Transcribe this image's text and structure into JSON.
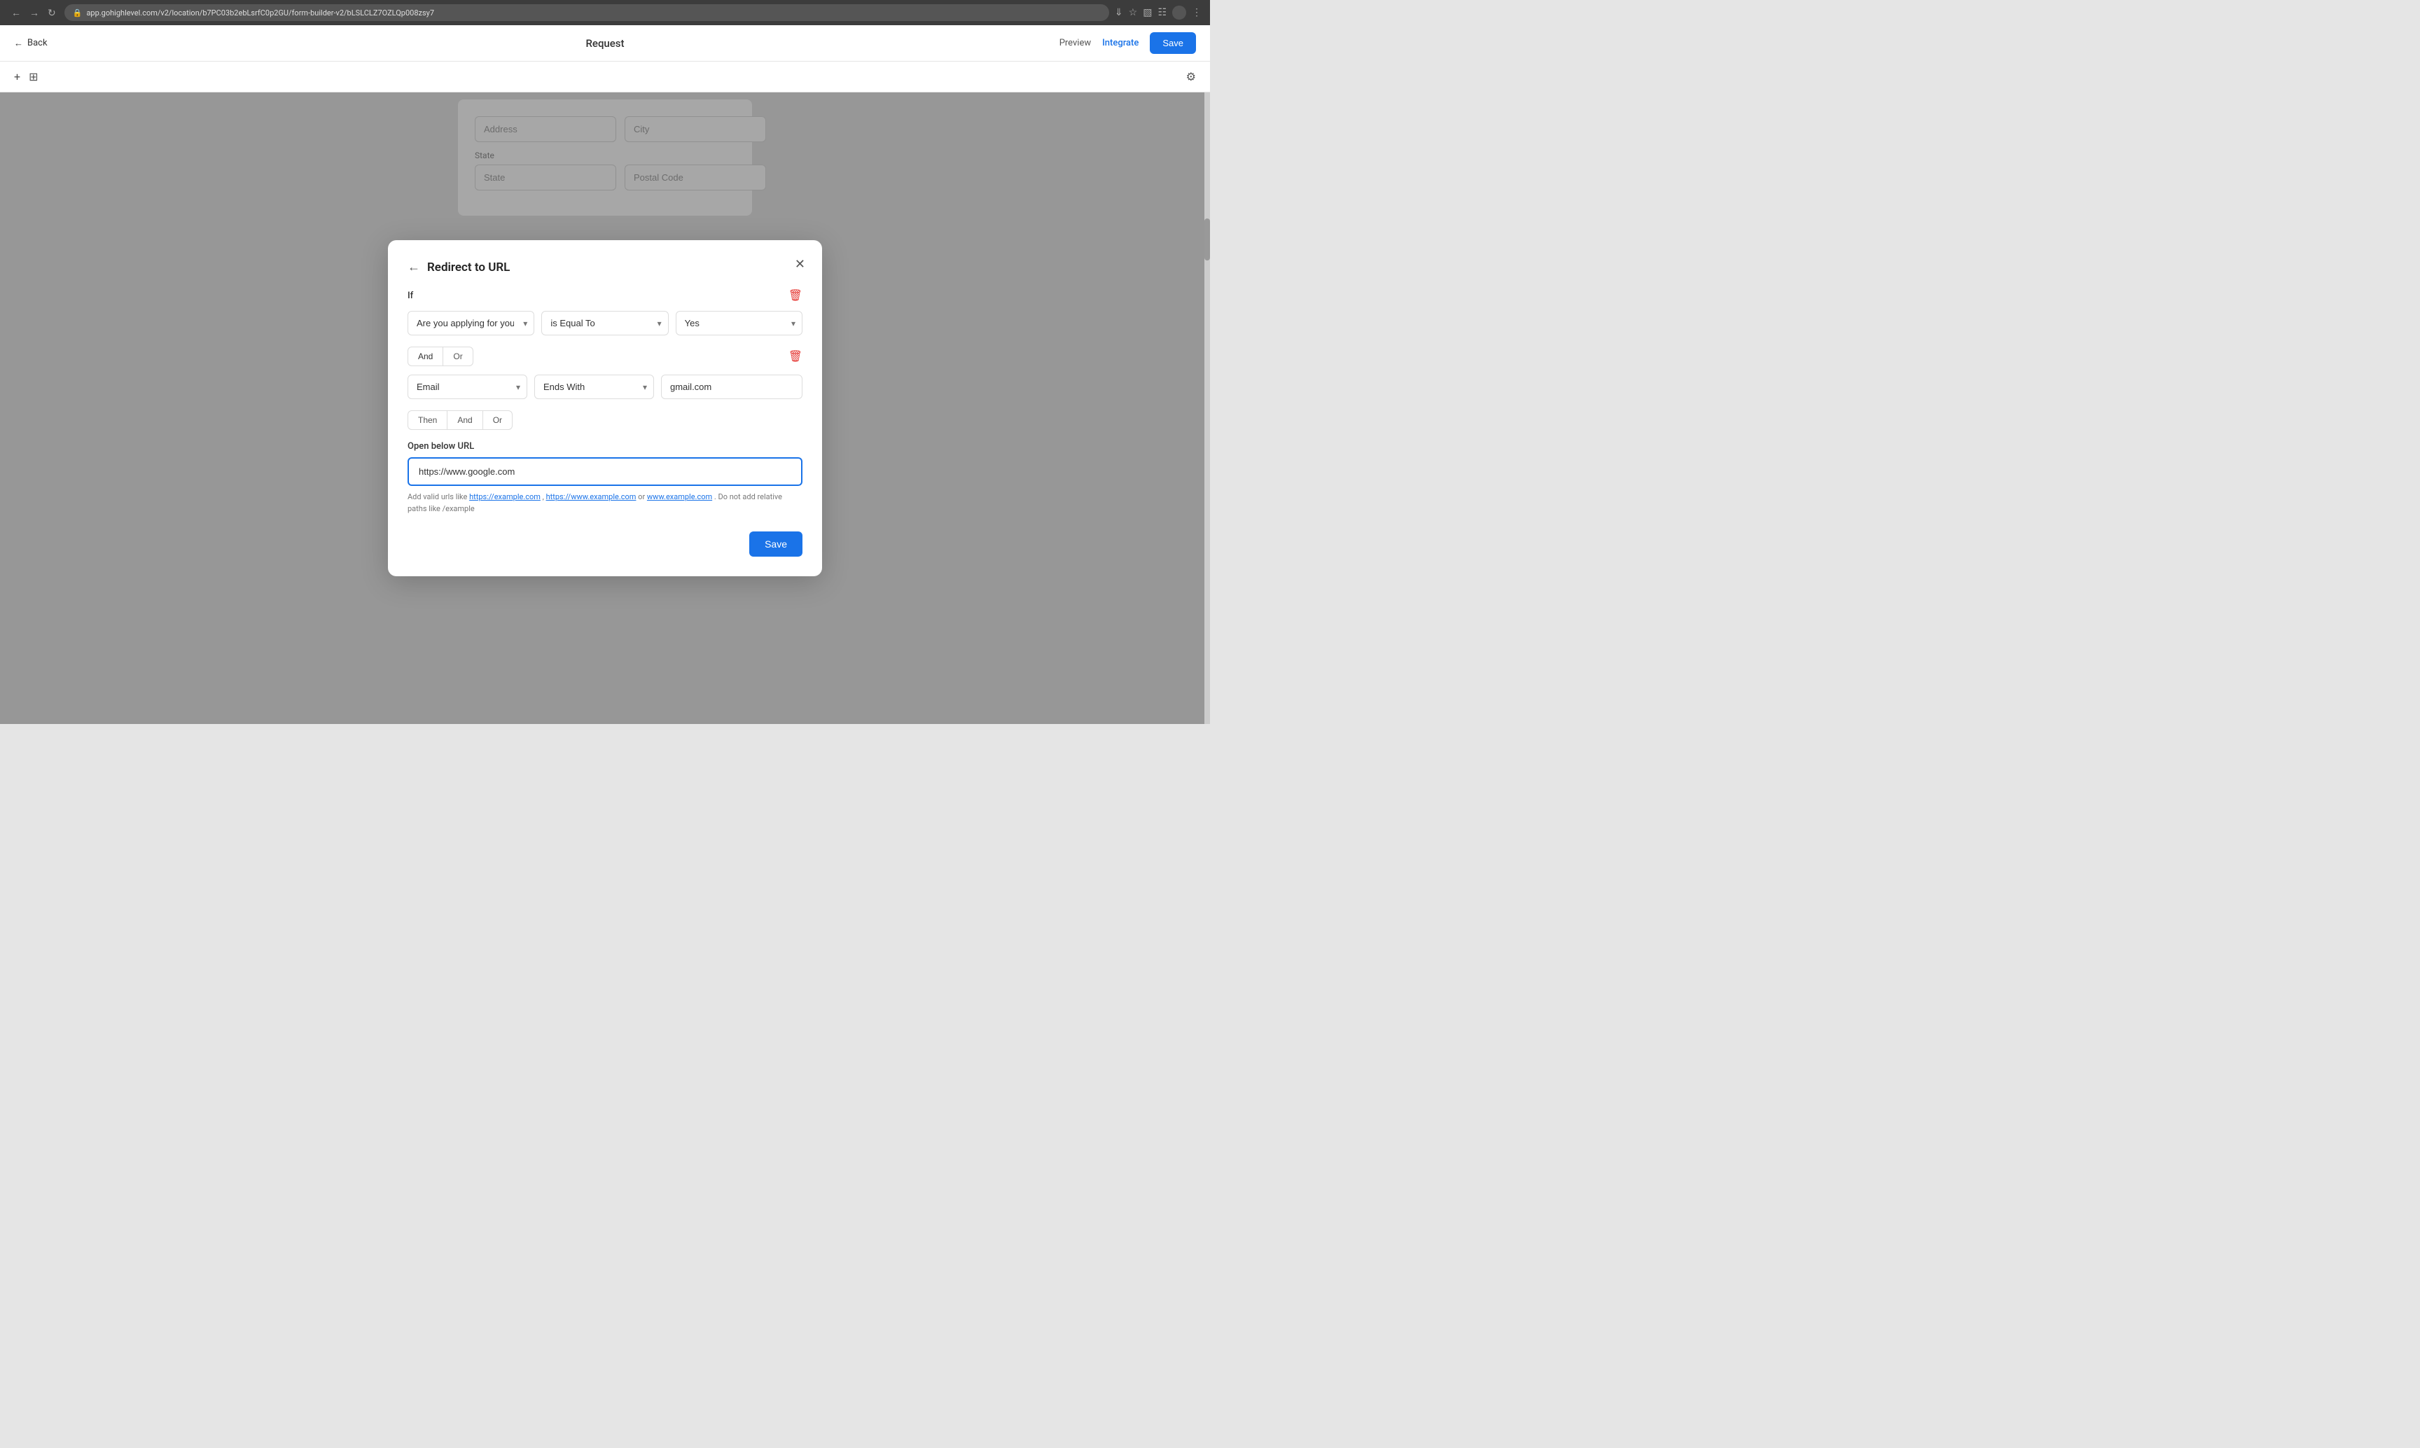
{
  "browser": {
    "url": "app.gohighlevel.com/v2/location/b7PC03b2ebLsrfC0p2GU/form-builder-v2/bLSLCLZ7OZLQp008zsy7",
    "back_title": "Back",
    "forward_title": "Forward",
    "reload_title": "Reload"
  },
  "header": {
    "back_label": "Back",
    "title": "Request",
    "preview_label": "Preview",
    "integrate_label": "Integrate",
    "save_label": "Save"
  },
  "toolbar": {
    "add_icon": "+",
    "layout_icon": "⊞"
  },
  "modal": {
    "title": "Redirect to URL",
    "if_label": "If",
    "condition1": {
      "field": "Are you applying for yourself?",
      "operator": "is Equal To",
      "value": "Yes"
    },
    "logic1": {
      "and_label": "And",
      "or_label": "Or"
    },
    "condition2": {
      "field": "Email",
      "operator": "Ends With",
      "value": "gmail.com"
    },
    "then_row": {
      "then_label": "Then",
      "and_label": "And",
      "or_label": "Or"
    },
    "url_section": {
      "label": "Open below URL",
      "value": "https://www.google.com",
      "hint_prefix": "Add valid urls like ",
      "hint_link1": "https://example.com",
      "hint_sep1": ", ",
      "hint_link2": "https://www.example.com",
      "hint_sep2": " or ",
      "hint_link3": "www.example.com",
      "hint_suffix": ". Do not add relative paths like /example"
    },
    "save_label": "Save"
  },
  "bg_form": {
    "address_placeholder": "Address",
    "city_placeholder": "City",
    "state_placeholder": "State",
    "postal_placeholder": "Postal Code"
  }
}
